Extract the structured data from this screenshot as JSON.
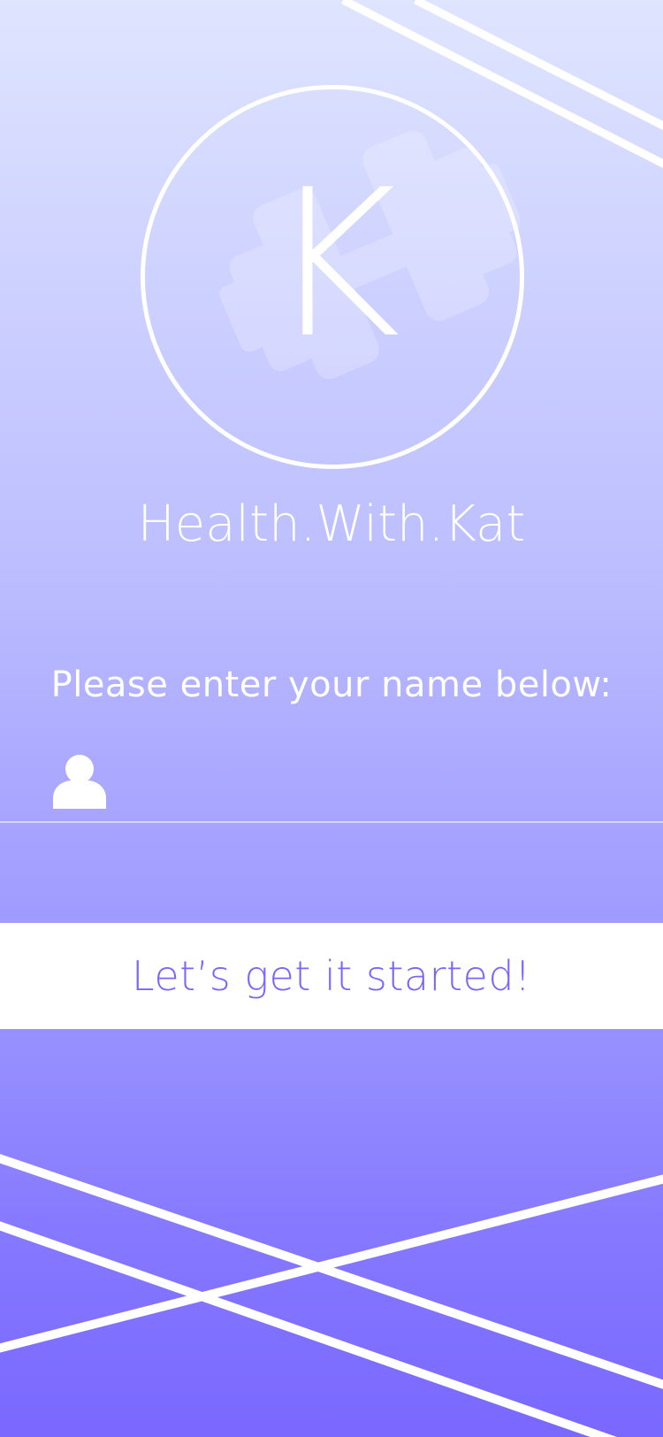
{
  "app": {
    "brand_name": "Health.With.Kat",
    "logo_letter": "K",
    "logo_icon": "dumbbell-icon"
  },
  "form": {
    "prompt": "Please enter your name below:",
    "name_input": {
      "value": "",
      "placeholder": "",
      "icon": "user-icon"
    },
    "submit_label": "Let’s get it started!"
  },
  "colors": {
    "gradient_top": "#dfe5ff",
    "gradient_bottom": "#7a68ff",
    "accent": "#7a66ff",
    "foreground": "#ffffff"
  }
}
